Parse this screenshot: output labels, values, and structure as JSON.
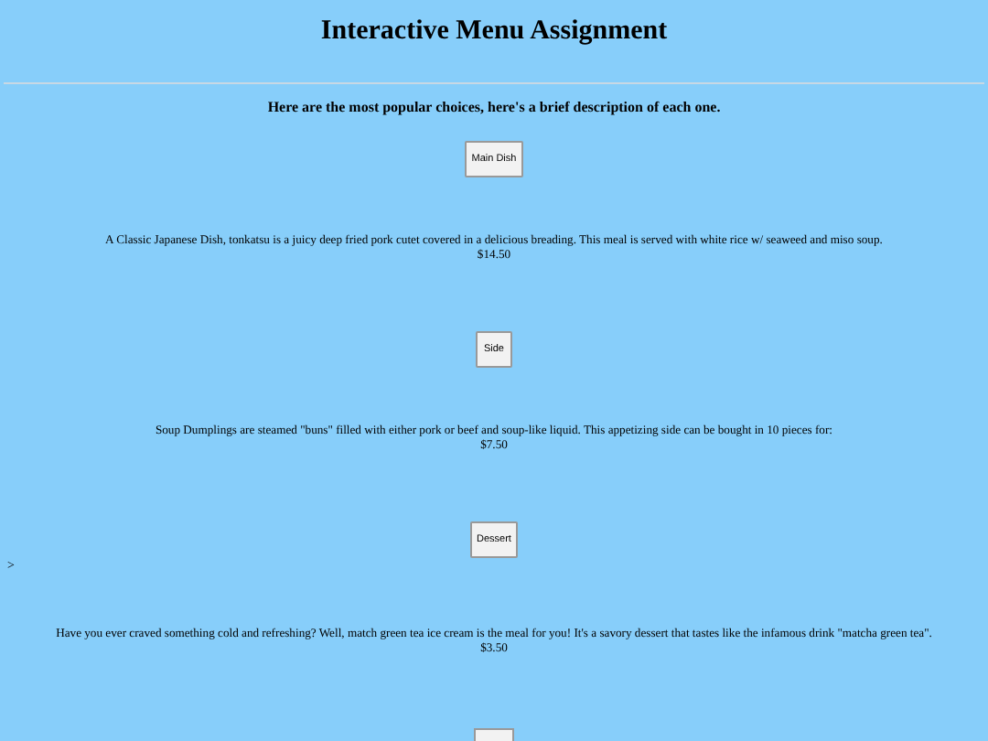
{
  "title": "Interactive Menu Assignment",
  "subtitle": "Here are the most popular choices, here's a brief description of each one.",
  "items": [
    {
      "button": "Main Dish",
      "description": "A Classic Japanese Dish, tonkatsu is a juicy deep fried pork cutet covered in a delicious breading. This meal is served with white rice w/ seaweed and miso soup.",
      "price": "$14.50"
    },
    {
      "button": "Side",
      "description": "Soup Dumplings are steamed \"buns\" filled with either pork or beef and soup-like liquid. This appetizing side can be bought in 10 pieces for:",
      "price": "$7.50"
    },
    {
      "button": "Dessert",
      "stray": ">",
      "description": "Have you ever craved something cold and refreshing? Well, match green tea ice cream is the meal for you! It's a savory dessert that tastes like the infamous drink \"matcha green tea\".",
      "price": "$3.50"
    }
  ],
  "more_below": true
}
